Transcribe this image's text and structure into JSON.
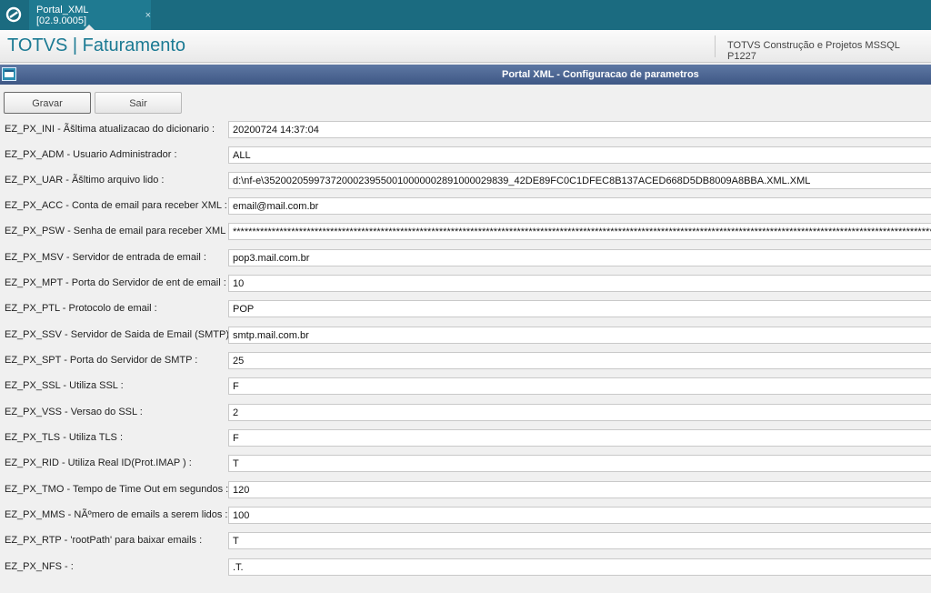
{
  "tab": {
    "label": "Portal_XML [02.9.0005]",
    "close": "×"
  },
  "header": {
    "title": "TOTVS | Faturamento",
    "environment": "TOTVS Construção e Projetos MSSQL P1227"
  },
  "window": {
    "title": "Portal XML - Configuracao de parametros"
  },
  "buttons": {
    "save": "Gravar",
    "exit": "Sair"
  },
  "params": [
    {
      "label": "EZ_PX_INI - Ãšltima atualizacao do dicionario :",
      "value": "20200724 14:37:04"
    },
    {
      "label": "EZ_PX_ADM - Usuario Administrador :",
      "value": "ALL"
    },
    {
      "label": "EZ_PX_UAR - Ãšltimo arquivo lido :",
      "value": "d:\\nf-e\\35200205997372000239550010000002891000029839_42DE89FC0C1DFEC8B137ACED668D5DB8009A8BBA.XML.XML"
    },
    {
      "label": "EZ_PX_ACC - Conta de email para receber XML :",
      "value": "email@mail.com.br"
    },
    {
      "label": "EZ_PX_PSW - Senha de email para receber XML :",
      "value": "****************************************************************************************************************************************************************************************************************************************************************"
    },
    {
      "label": "EZ_PX_MSV - Servidor de entrada de email :",
      "value": "pop3.mail.com.br"
    },
    {
      "label": "EZ_PX_MPT - Porta do Servidor de ent de email :",
      "value": "10"
    },
    {
      "label": "EZ_PX_PTL - Protocolo de email :",
      "value": "POP"
    },
    {
      "label": "EZ_PX_SSV - Servidor de Saida de Email (SMTP) :",
      "value": "smtp.mail.com.br"
    },
    {
      "label": "EZ_PX_SPT - Porta do Servidor de SMTP :",
      "value": "25"
    },
    {
      "label": "EZ_PX_SSL - Utiliza SSL :",
      "value": "F"
    },
    {
      "label": "EZ_PX_VSS - Versao do SSL :",
      "value": "2"
    },
    {
      "label": "EZ_PX_TLS - Utiliza TLS :",
      "value": "F"
    },
    {
      "label": "EZ_PX_RID - Utiliza Real ID(Prot.IMAP ) :",
      "value": "T"
    },
    {
      "label": "EZ_PX_TMO - Tempo de Time Out em segundos :",
      "value": "120"
    },
    {
      "label": "EZ_PX_MMS - NÃºmero de emails a serem lidos :",
      "value": "100"
    },
    {
      "label": "EZ_PX_RTP - 'rootPath' para baixar emails :",
      "value": "T"
    },
    {
      "label": "EZ_PX_NFS -  :",
      "value": ".T."
    }
  ],
  "colors": {
    "tabbar": "#1b6b80",
    "title_accent": "#1b7a93",
    "window_bar": "#4a6491"
  }
}
